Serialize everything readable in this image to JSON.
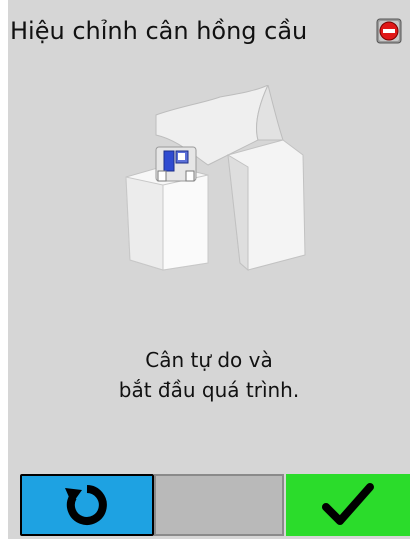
{
  "header": {
    "title": "Hiệu chỉnh cân hồng cầu",
    "status_icon": "stop-alert-icon"
  },
  "main": {
    "illustration": "blood-bag-scale-device",
    "message_line1": "Cân tự do và",
    "message_line2": "bắt đầu quá trình."
  },
  "buttons": {
    "refresh": {
      "icon": "refresh-icon",
      "color": "#1ea2e2"
    },
    "blank": {
      "color": "#b9b9b9"
    },
    "confirm": {
      "icon": "checkmark-icon",
      "color": "#2bdc2b"
    }
  }
}
